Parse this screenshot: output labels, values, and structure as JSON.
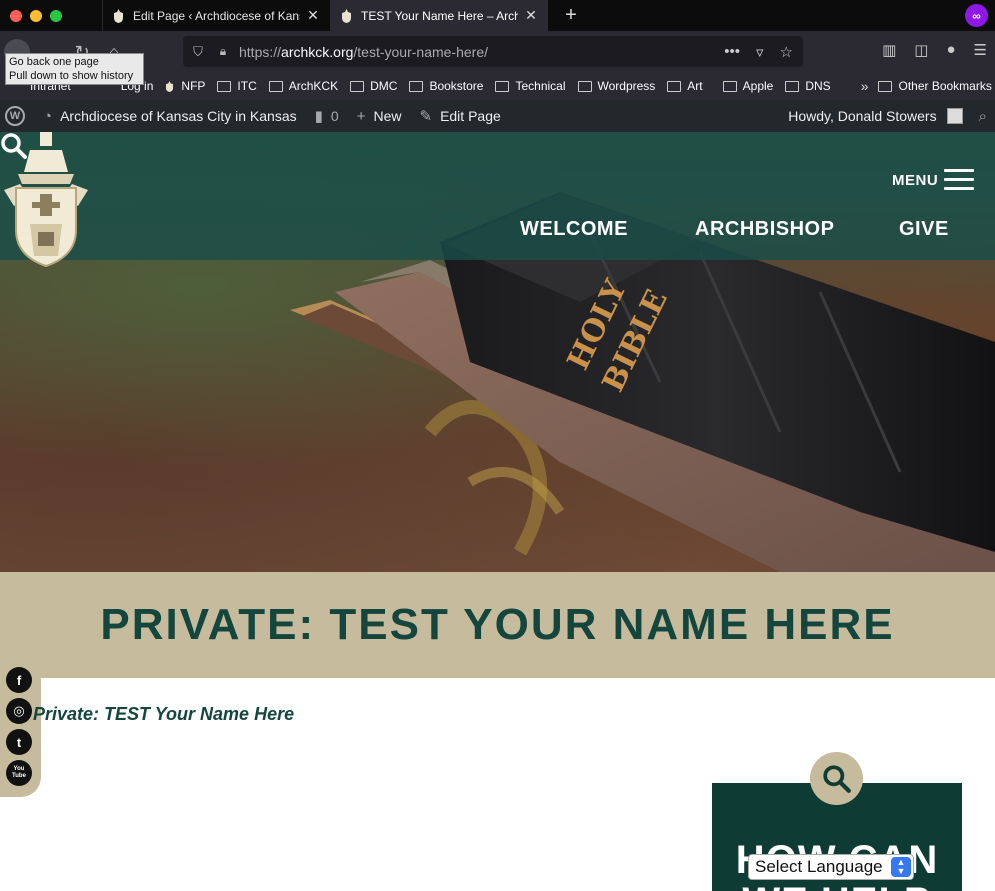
{
  "browser": {
    "tabs": [
      {
        "title": "Edit Page ‹ Archdiocese of Kansas City in Kansas",
        "close": "✕"
      },
      {
        "title": "TEST Your Name Here – Archdiocese of Kansas City in Kansas",
        "close": "✕"
      }
    ],
    "new_tab": "+",
    "url_domain": "archkck.org",
    "url_prefix": "https://",
    "url_path": "/test-your-name-here/",
    "tooltip_line1": "Go back one page",
    "tooltip_line2": "Pull down to show history",
    "bookmarks": [
      "Intranet",
      "Log in",
      "NFP",
      "ITC",
      "ArchKCK",
      "DMC",
      "Bookstore",
      "Technical",
      "Wordpress",
      "Art",
      "Apple",
      "DNS"
    ],
    "other_bookmarks": "Other Bookmarks"
  },
  "adminbar": {
    "site_name": "Archdiocese of Kansas City in Kansas",
    "comments_count": "0",
    "new_label": "New",
    "edit_label": "Edit Page",
    "howdy": "Howdy, Donald Stowers"
  },
  "site": {
    "menu_label": "MENU",
    "nav": [
      "WELCOME",
      "ARCHBISHOP",
      "GIVE"
    ],
    "hero_book_line1": "HOLY",
    "hero_book_line2": "BIBLE",
    "page_title": "PRIVATE: TEST YOUR NAME HERE",
    "breadcrumb": "Private: TEST Your Name Here",
    "social": [
      "f",
      "◎",
      "t",
      "You Tube"
    ],
    "sidebar_heading": "HOW CAN WE HELP",
    "language_select": "Select Language"
  },
  "colors": {
    "header_teal": "#1a4d48",
    "title_band": "#c6bc9d",
    "title_text": "#14463e",
    "sidebar_dark": "#0f3b35"
  }
}
